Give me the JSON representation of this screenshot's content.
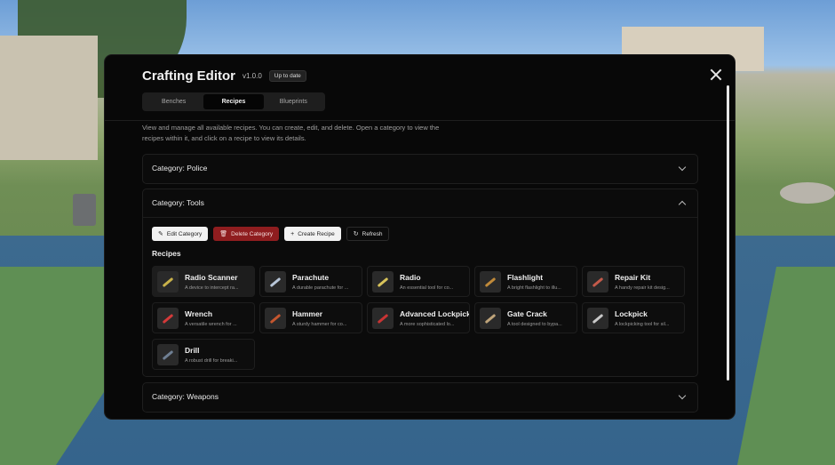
{
  "modal": {
    "title": "Crafting Editor",
    "version": "v1.0.0",
    "status": "Up to date",
    "close_icon": "close-icon"
  },
  "tabs": [
    {
      "label": "Benches",
      "active": false
    },
    {
      "label": "Recipes",
      "active": true
    },
    {
      "label": "Blueprints",
      "active": false
    }
  ],
  "description": "View and manage all available recipes. You can create, edit, and delete. Open a category to view the recipes within it, and click on a recipe to view its details.",
  "categories": [
    {
      "label": "Category: Police",
      "expanded": false
    },
    {
      "label": "Category: Tools",
      "expanded": true
    },
    {
      "label": "Category: Weapons",
      "expanded": false
    }
  ],
  "actions": {
    "edit": "Edit Category",
    "delete": "Delete Category",
    "create": "Create Recipe",
    "refresh": "Refresh"
  },
  "recipes_label": "Recipes",
  "recipes": [
    {
      "name": "Radio Scanner",
      "desc": "A device to intercept ra...",
      "icon": "scanner-icon",
      "color": "#c9b24a"
    },
    {
      "name": "Parachute",
      "desc": "A durable parachute for ...",
      "icon": "parachute-icon",
      "color": "#b8c6d8"
    },
    {
      "name": "Radio",
      "desc": "An essential tool for co...",
      "icon": "radio-icon",
      "color": "#d8c35a"
    },
    {
      "name": "Flashlight",
      "desc": "A bright flashlight to illu...",
      "icon": "flashlight-icon",
      "color": "#c08a3a"
    },
    {
      "name": "Repair Kit",
      "desc": "A handy repair kit desig...",
      "icon": "toolbox-icon",
      "color": "#c45a4a"
    },
    {
      "name": "Wrench",
      "desc": "A versatile wrench for ...",
      "icon": "wrench-icon",
      "color": "#d43a3a"
    },
    {
      "name": "Hammer",
      "desc": "A sturdy hammer for co...",
      "icon": "hammer-icon",
      "color": "#c4562f"
    },
    {
      "name": "Advanced Lockpick",
      "desc": "A more sophisticated lo...",
      "icon": "lockpick-icon",
      "color": "#c93434"
    },
    {
      "name": "Gate Crack",
      "desc": "A tool designed to bypa...",
      "icon": "drill-icon",
      "color": "#bfa47a"
    },
    {
      "name": "Lockpick",
      "desc": "A lockpicking tool for sil...",
      "icon": "lock-icon",
      "color": "#c9c9c9"
    },
    {
      "name": "Drill",
      "desc": "A robust drill for breaki...",
      "icon": "drill-icon",
      "color": "#6f7f93"
    }
  ]
}
